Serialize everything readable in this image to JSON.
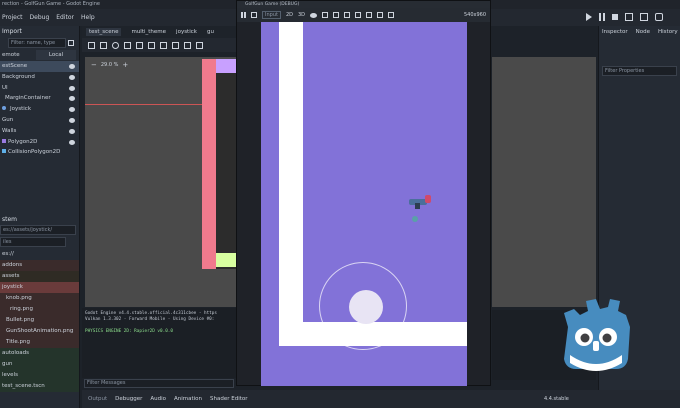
{
  "editor": {
    "title": "rection - GolfGun Game - Godot Engine",
    "menu": [
      "Project",
      "Debug",
      "Editor",
      "Help"
    ],
    "version_label": "4.4.stable"
  },
  "scene_dock": {
    "header": "Import",
    "filter_placeholder": "Filter: name, type",
    "remote_label": "emote",
    "local_label": "Local",
    "tree": [
      {
        "name": "estScene",
        "selected": true
      },
      {
        "name": "Background"
      },
      {
        "name": "UI"
      },
      {
        "name": "MarginContainer"
      },
      {
        "name": "Joystick"
      },
      {
        "name": "Gun"
      },
      {
        "name": "Walls"
      },
      {
        "name": "Polygon2D"
      },
      {
        "name": "CollisionPolygon2D"
      }
    ]
  },
  "filesystem_dock": {
    "header": "stem",
    "path": "es://assets/joystick/",
    "filter_placeholder": "iles",
    "items": [
      {
        "name": "es://"
      },
      {
        "name": "addons"
      },
      {
        "name": "assets"
      },
      {
        "name": "joystick",
        "selected": true
      },
      {
        "name": "knob.png"
      },
      {
        "name": "ring.png"
      },
      {
        "name": "Bullet.png"
      },
      {
        "name": "GunShootAnimation.png"
      },
      {
        "name": "Title.png"
      },
      {
        "name": "autoloads"
      },
      {
        "name": "gun"
      },
      {
        "name": "levels"
      },
      {
        "name": "test_scene.tscn"
      }
    ]
  },
  "center": {
    "tabs": [
      "test_scene",
      "multi_theme",
      "joystick",
      "gu"
    ],
    "zoom": "29.0 %",
    "output_lines": [
      "Godot Engine v4.4.stable.official.4c311cbee - https",
      "Vulkan 1.3.302 - Forward Mobile - Using Device #0:",
      "",
      "PHYSICS ENGINE 2D: Rapier2D v0.0.0"
    ],
    "filter_messages": "Filter Messages",
    "bottom_tabs": [
      "Output",
      "Debugger",
      "Audio",
      "Animation",
      "Shader Editor"
    ]
  },
  "game_window": {
    "title": "GolfGun Game (DEBUG)",
    "toolbar_items": [
      "Input",
      "2D",
      "3D"
    ],
    "resolution": "540x960"
  },
  "inspector": {
    "tabs": [
      "Inspector",
      "Node",
      "History"
    ],
    "filter_placeholder": "Filter Properties"
  },
  "colors": {
    "game_bg": "#8272d8",
    "wall": "#ffffff",
    "godot_blue": "#478cbf"
  }
}
